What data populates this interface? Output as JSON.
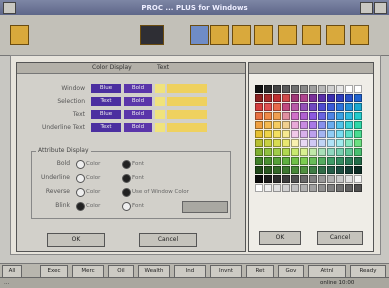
{
  "window": {
    "title": "PROC ... PLUS for Windows"
  },
  "dialog": {
    "title": "Color Display",
    "tab": "Text",
    "rows": [
      {
        "label": "Window",
        "a": "Blue",
        "b": "Bold"
      },
      {
        "label": "Selection",
        "a": "Text",
        "b": "Bold"
      },
      {
        "label": "Text",
        "a": "Blue",
        "b": "Bold"
      },
      {
        "label": "Underline Text",
        "a": "Text",
        "b": "Bold"
      }
    ],
    "attr_group": "Attribute Display",
    "attributes": [
      {
        "label": "Bold",
        "opt1": "Color",
        "opt2": "Font"
      },
      {
        "label": "Underline",
        "opt1": "Color",
        "opt2": "Font"
      },
      {
        "label": "Reverse",
        "opt1": "Color",
        "opt2": "Use of Window Color"
      },
      {
        "label": "Blink",
        "opt1": "Color",
        "opt2": "Font"
      }
    ],
    "ok_label": "OK",
    "cancel_label": "Cancel"
  },
  "palette": {
    "ok_label": "OK",
    "cancel_label": "Cancel",
    "colors": [
      "#101010",
      "#2a2a2a",
      "#444444",
      "#5a5a5a",
      "#707070",
      "#888888",
      "#a0a0a0",
      "#b8b8b8",
      "#cfcfcf",
      "#e6e6e6",
      "#ffffff",
      "#ffffff",
      "#8a2020",
      "#a52a2a",
      "#c03030",
      "#d04a4a",
      "#a03878",
      "#b04490",
      "#7a2f9a",
      "#5a2ea8",
      "#3c2fb0",
      "#2e3ebd",
      "#2850c8",
      "#1f63d0",
      "#d43c3c",
      "#e05050",
      "#e86a4a",
      "#c04a80",
      "#b858a8",
      "#9450b8",
      "#7048c0",
      "#4e4ad0",
      "#3a5ad8",
      "#2e74dc",
      "#2390d8",
      "#1aa8d0",
      "#e87040",
      "#f08a48",
      "#f0a050",
      "#e090a0",
      "#d070c8",
      "#b060d0",
      "#8c5ae0",
      "#6a64e0",
      "#4e84e6",
      "#3aa2e4",
      "#2cbce0",
      "#22cccc",
      "#f0a040",
      "#f4b850",
      "#f6cc60",
      "#f0d090",
      "#e8a8d8",
      "#c88ae0",
      "#a878e6",
      "#8890ec",
      "#6aacee",
      "#52c4ea",
      "#3ad4d4",
      "#2ed8a8",
      "#e6c030",
      "#eed448",
      "#f4e060",
      "#f6ea90",
      "#f0c8e8",
      "#d8b0ec",
      "#bca0ee",
      "#a4b4f2",
      "#90ccf4",
      "#78dcf0",
      "#5ae0c8",
      "#48dc90",
      "#b8c030",
      "#c8d040",
      "#d8dc50",
      "#e8e870",
      "#f8f0b0",
      "#e8d8f4",
      "#d0c8f4",
      "#c0d4f6",
      "#b0e2f6",
      "#a0eaec",
      "#86e8c0",
      "#6ae080",
      "#80b030",
      "#90c040",
      "#a0cc48",
      "#b0d850",
      "#c8e870",
      "#d8f090",
      "#c0e8a8",
      "#a8e0b8",
      "#90d8c0",
      "#78d0b0",
      "#60c898",
      "#48c070",
      "#408028",
      "#4a9030",
      "#56a038",
      "#60b040",
      "#70c048",
      "#7ccc50",
      "#68bc58",
      "#54ac60",
      "#409c68",
      "#348c60",
      "#2a7c58",
      "#226c48",
      "#204818",
      "#2a5820",
      "#346828",
      "#3e7830",
      "#488838",
      "#509040",
      "#3e7c44",
      "#306c48",
      "#245c48",
      "#1c4c40",
      "#143c34",
      "#0c2c24",
      "#0c0c0c",
      "#1c1c1c",
      "#2c2c2c",
      "#3c3c3c",
      "#505050",
      "#686868",
      "#808080",
      "#989898",
      "#b0b0b0",
      "#c8c8c8",
      "#e0e0e0",
      "#f4f4f4",
      "#ffffff",
      "#f0f0f0",
      "#e0e0e0",
      "#d0d0d0",
      "#c0c0c0",
      "#b0b0b0",
      "#a0a0a0",
      "#909090",
      "#808080",
      "#707070",
      "#606060",
      "#505050"
    ]
  },
  "taskbar": {
    "items": [
      "All",
      "Exec",
      "Merc",
      "Oil",
      "Wealth",
      "Ind",
      "Invnt",
      "Ret",
      "Gov",
      "Attnl",
      "Ready"
    ]
  },
  "status": {
    "left": "...",
    "right": "online  10:00"
  }
}
